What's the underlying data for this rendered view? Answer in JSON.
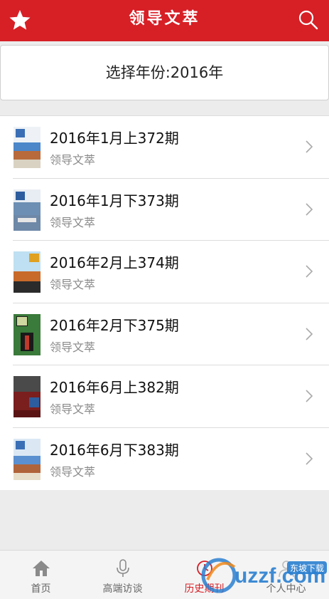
{
  "header": {
    "title": "领导文萃"
  },
  "year_selector": {
    "label": "选择年份:2016年"
  },
  "issues": [
    {
      "title": "2016年1月上372期",
      "subtitle": "领导文萃"
    },
    {
      "title": "2016年1月下373期",
      "subtitle": "领导文萃"
    },
    {
      "title": "2016年2月上374期",
      "subtitle": "领导文萃"
    },
    {
      "title": "2016年2月下375期",
      "subtitle": "领导文萃"
    },
    {
      "title": "2016年6月上382期",
      "subtitle": "领导文萃"
    },
    {
      "title": "2016年6月下383期",
      "subtitle": "领导文萃"
    }
  ],
  "tabs": [
    {
      "label": "首页",
      "icon": "home-icon"
    },
    {
      "label": "高端访谈",
      "icon": "microphone-icon"
    },
    {
      "label": "历史期刊",
      "icon": "history-icon",
      "active": true
    },
    {
      "label": "个人中心",
      "icon": "user-icon"
    }
  ],
  "watermark": {
    "text": "uzzf.com",
    "badge": "东坡下载"
  },
  "colors": {
    "brand_red": "#d71f26",
    "background": "#ececec"
  }
}
